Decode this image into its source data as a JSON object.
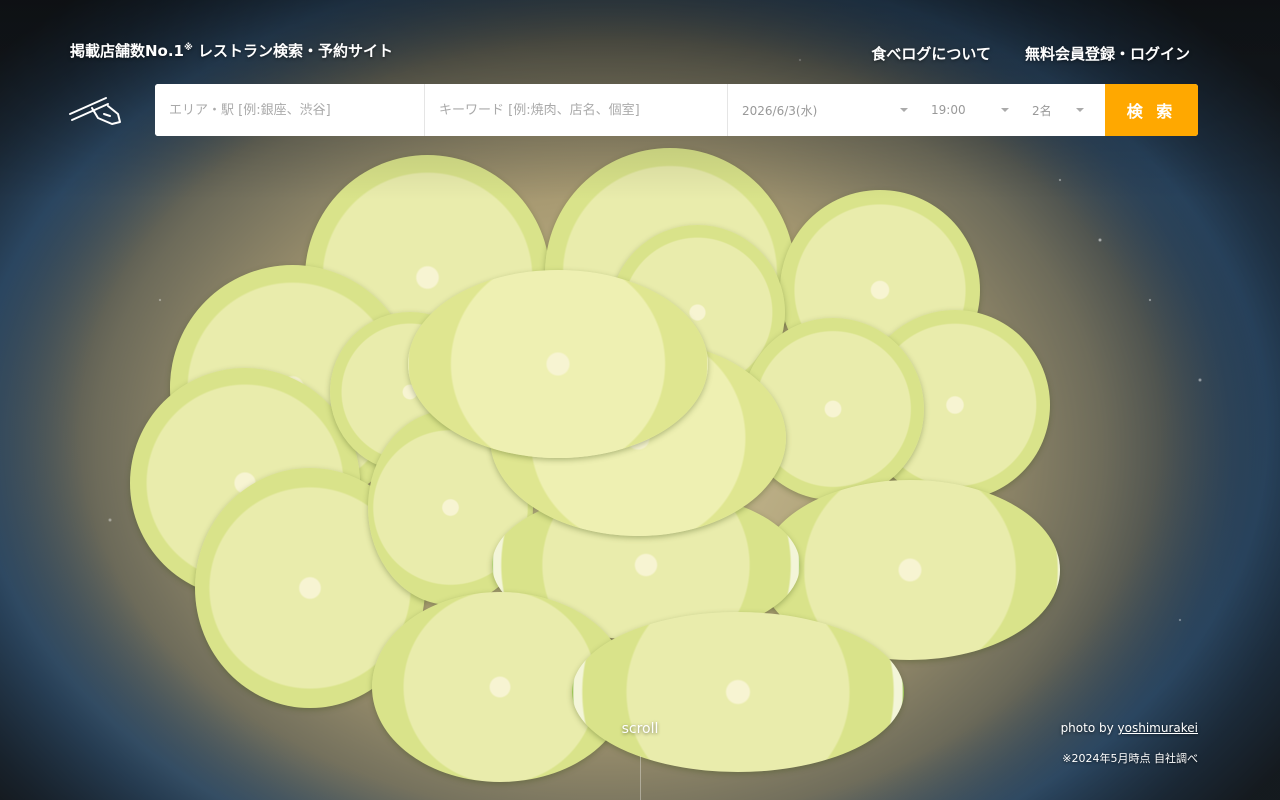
{
  "header": {
    "tagline_main": "掲載店舗数No.1",
    "tagline_mark": "※",
    "tagline_rest": " レストラン検索・予約サイト",
    "nav": {
      "about": "食べログについて",
      "login": "無料会員登録・ログイン"
    },
    "logo_icon": "chopsticks-hand-icon"
  },
  "search": {
    "area_placeholder": "エリア・駅 [例:銀座、渋谷]",
    "keyword_placeholder": "キーワード [例:焼肉、店名、個室]",
    "date_value": "2026/6/3(水)",
    "time_value": "19:00",
    "people_value": "2名",
    "button_label": "検 索",
    "accent_color": "#ffa800"
  },
  "footer": {
    "scroll_label": "scroll",
    "photo_prefix": "photo by ",
    "photo_author": "yoshimurakei",
    "footnote": "※2024年5月時点 自社調べ"
  }
}
